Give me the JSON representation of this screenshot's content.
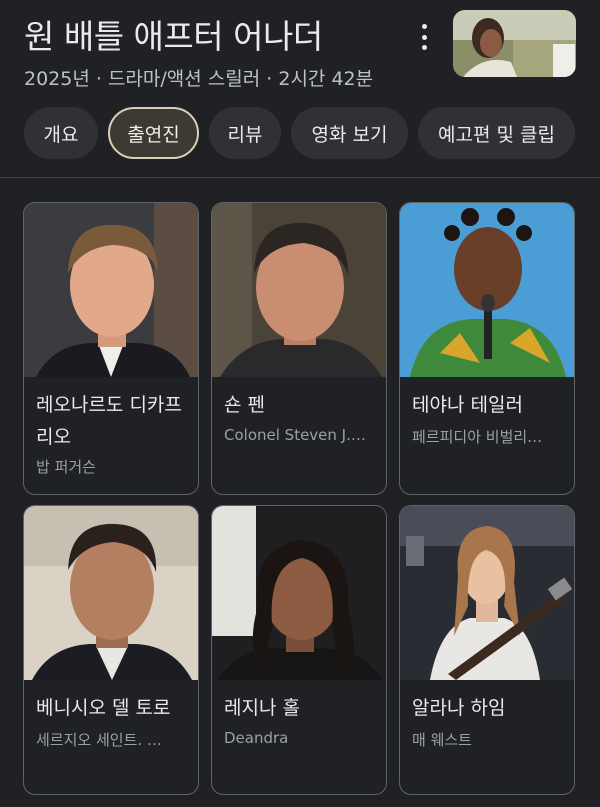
{
  "header": {
    "title": "원 배틀 애프터 어나더",
    "subtitle": "2025년 · 드라마/액션 스릴러 · 2시간 42분"
  },
  "tabs": [
    {
      "label": "개요"
    },
    {
      "label": "출연진",
      "active": true
    },
    {
      "label": "리뷰"
    },
    {
      "label": "영화 보기"
    },
    {
      "label": "예고편 및 클립"
    }
  ],
  "cast": [
    {
      "name": "레오나르도 디카프리오",
      "role": "밥 퍼거슨"
    },
    {
      "name": "숀 펜",
      "role": "Colonel Steven J.…"
    },
    {
      "name": "테야나 테일러",
      "role": "페르피디아 비벌리…"
    },
    {
      "name": "베니시오 델 토로",
      "role": "세르지오 세인트. …"
    },
    {
      "name": "레지나 홀",
      "role": "Deandra"
    },
    {
      "name": "알라나 하임",
      "role": "매 웨스트"
    }
  ],
  "colors": {
    "background": "#202124",
    "card_border": "#5f6368",
    "active_tab_border": "#d9d0b8",
    "secondary_text": "#9aa0a6"
  }
}
